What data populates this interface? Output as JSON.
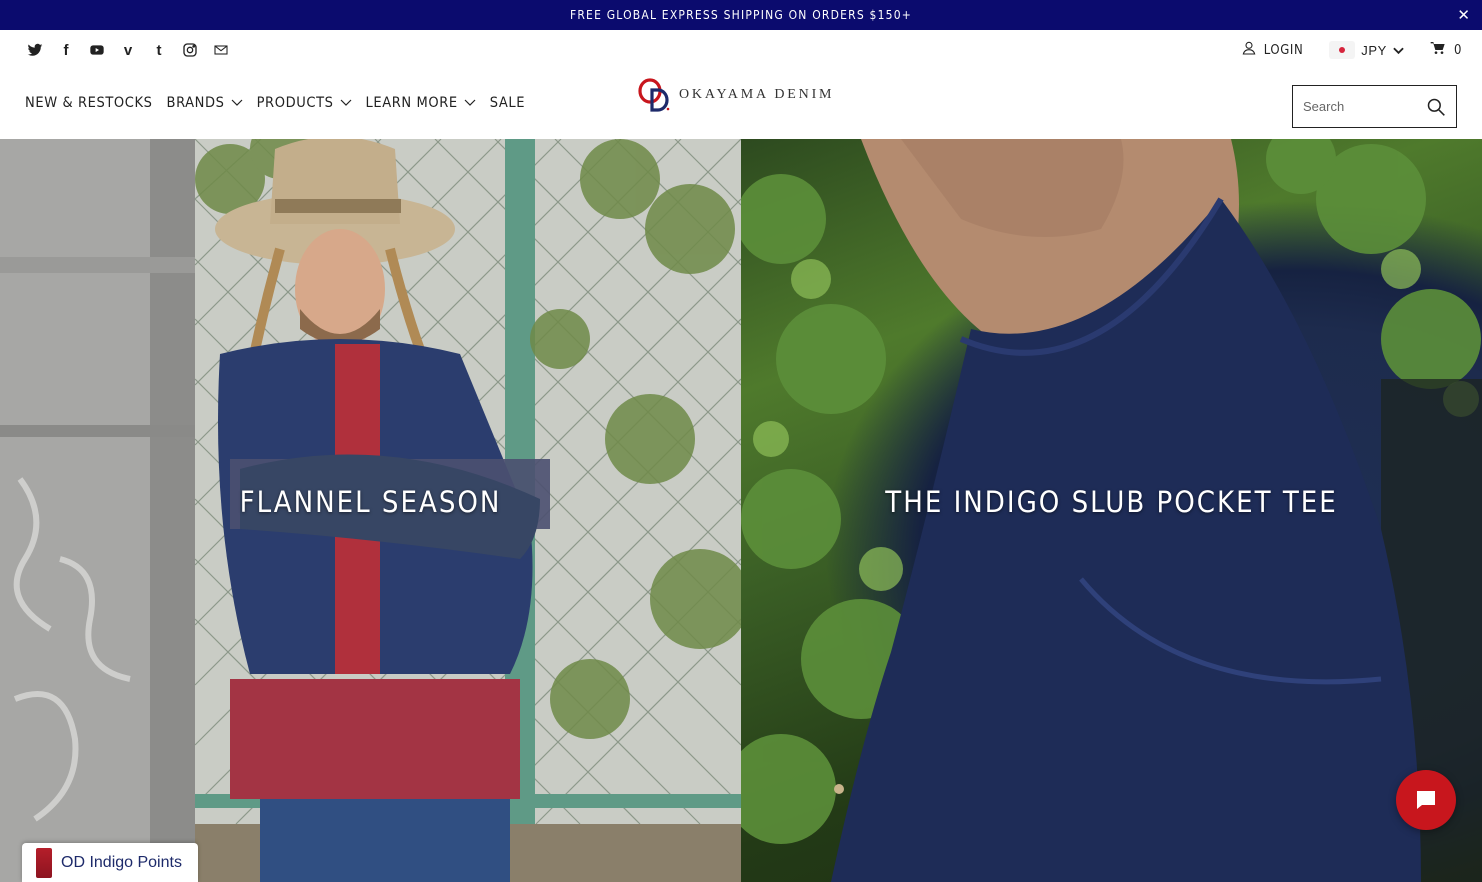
{
  "announcement": {
    "text": "FREE GLOBAL EXPRESS SHIPPING ON ORDERS $150+",
    "close_icon": "close-icon",
    "bg_color": "#0b0b6e"
  },
  "social": {
    "icons": [
      "twitter-icon",
      "facebook-icon",
      "youtube-icon",
      "vimeo-icon",
      "tumblr-icon",
      "instagram-icon",
      "email-icon"
    ],
    "glyphs": {
      "twitter": "🐦",
      "facebook": "f",
      "vimeo": "v",
      "tumblr": "t"
    }
  },
  "account": {
    "login_label": "LOGIN",
    "currency": "JPY",
    "cart_count": "0"
  },
  "nav": {
    "items": [
      {
        "label": "NEW & RESTOCKS",
        "has_dropdown": false
      },
      {
        "label": "BRANDS",
        "has_dropdown": true
      },
      {
        "label": "PRODUCTS",
        "has_dropdown": true
      },
      {
        "label": "LEARN MORE",
        "has_dropdown": true
      },
      {
        "label": "SALE",
        "has_dropdown": false
      }
    ]
  },
  "logo": {
    "text": "OKAYAMA DENIM",
    "brand_red": "#c8161d",
    "brand_navy": "#1d2a6a"
  },
  "search": {
    "placeholder": "Search"
  },
  "hero": {
    "left_title": "FLANNEL SEASON",
    "right_title": "THE INDIGO SLUB POCKET TEE"
  },
  "widgets": {
    "points_label": "OD Indigo Points",
    "chat_color": "#c8161d"
  }
}
